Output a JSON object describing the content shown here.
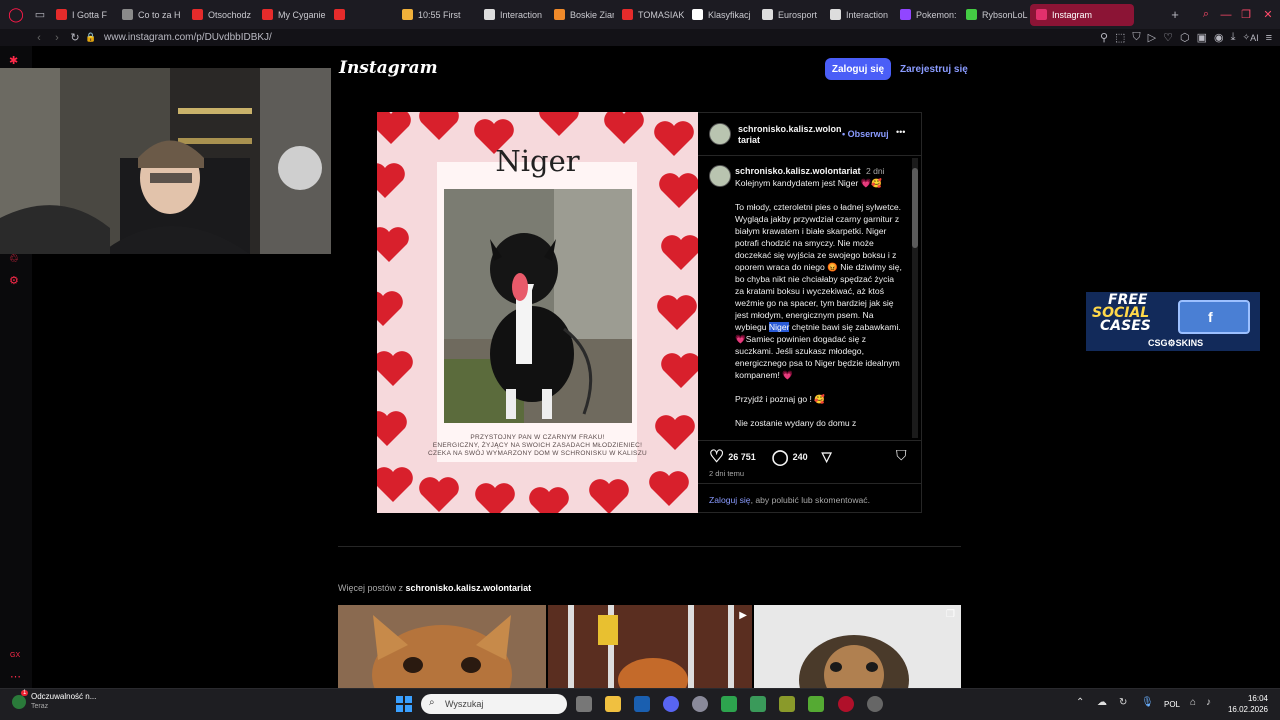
{
  "browser": {
    "tabs": [
      {
        "label": "I Gotta F",
        "color": "#e52b2b"
      },
      {
        "label": "Co to za H",
        "color": "#8a8a8a"
      },
      {
        "label": "Otsochodz",
        "color": "#e52b2b"
      },
      {
        "label": "My Cyganie",
        "color": "#e52b2b"
      },
      {
        "label": "",
        "color": "#e52b2b"
      },
      {
        "label": "10:55 First",
        "color": "#f0b03a"
      },
      {
        "label": "Interaction",
        "color": "#dddddd"
      },
      {
        "label": "Boskie Ziar",
        "color": "#f08a2a"
      },
      {
        "label": "TOMASIAK",
        "color": "#e52b2b"
      },
      {
        "label": "Klasyfikacj",
        "color": "#ffffff"
      },
      {
        "label": "Eurosport",
        "color": "#dddddd"
      },
      {
        "label": "Interaction",
        "color": "#dddddd"
      },
      {
        "label": "Pokemon: F",
        "color": "#9146ff"
      },
      {
        "label": "RybsonLoL",
        "color": "#44cc44"
      },
      {
        "label": "Instagram",
        "color": "#e1306c"
      }
    ],
    "new_tab": "+",
    "url": "www.instagram.com/p/DUvdbbIDBKJ/",
    "ai_label": "AI"
  },
  "instagram": {
    "logo": "Instagram",
    "login_button": "Zaloguj się",
    "signup_button": "Zarejestruj się"
  },
  "post": {
    "image_title": "Niger",
    "image_caption_lines": [
      "PRZYSTOJNY PAN W CZARNYM FRAKU!",
      "ENERGICZNY, ŻYJĄCY NA SWOICH ZASADACH MŁODZIENIEC!",
      "CZEKA NA SWÓJ WYMARZONY DOM W SCHRONISKU W KALISZU"
    ],
    "header_username_line1": "schronisko.kalisz.wolon",
    "header_username_line2": "tariat",
    "follow": "• Obserwuj",
    "more_menu": "•••",
    "caption_username": "schronisko.kalisz.wolontariat",
    "caption_time": "2 dni",
    "caption_first": "Kolejnym kandydatem jest Niger 💗🥰",
    "caption_body_before": "To młody, czteroletni pies o ładnej sylwetce. Wygląda jakby przywdział czarny garnitur z białym krawatem i białe skarpetki. Niger potrafi chodzić na smyczy. Nie może doczekać się wyjścia ze swojego boksu i z oporem wraca do niego 😡 Nie dziwimy się, bo chyba nikt nie chciałaby spędzać życia za kratami boksu i wyczekiwać, aż ktoś weźmie go na spacer, tym bardziej jak się jest młodym, energicznym psem. Na wybiegu ",
    "caption_highlight": "Niger",
    "caption_body_after": " chętnie bawi się zabawkami. 💗Samiec powinien dogadać się z suczkami. Jeśli szukasz młodego, energicznego psa to Niger będzie idealnym kompanem! 💗",
    "caption_p2": "Przyjdź i poznaj go ! 🥰",
    "caption_p3": "Nie zostanie wydany do domu z",
    "likes": "26 751",
    "comments": "240",
    "posted": "2 dni temu",
    "login_prompt_link": "Zaloguj się",
    "login_prompt_rest": ", aby polubić lub skomentować."
  },
  "more_posts": {
    "prefix": "Więcej postów z ",
    "username": "schronisko.kalisz.wolontariat"
  },
  "ad": {
    "line1": "FREE",
    "line2": "SOCIAL",
    "line3": "CASES",
    "brand": "CSG⚙SKINS"
  },
  "taskbar": {
    "notification_title": "Odczuwalność n...",
    "notification_sub": "Teraz",
    "notification_badge": "1",
    "search_placeholder": "Wyszukaj",
    "lang": "POL",
    "time": "16:04",
    "date": "16.02.2026"
  },
  "sidebar": {
    "gx_label": "GX"
  }
}
